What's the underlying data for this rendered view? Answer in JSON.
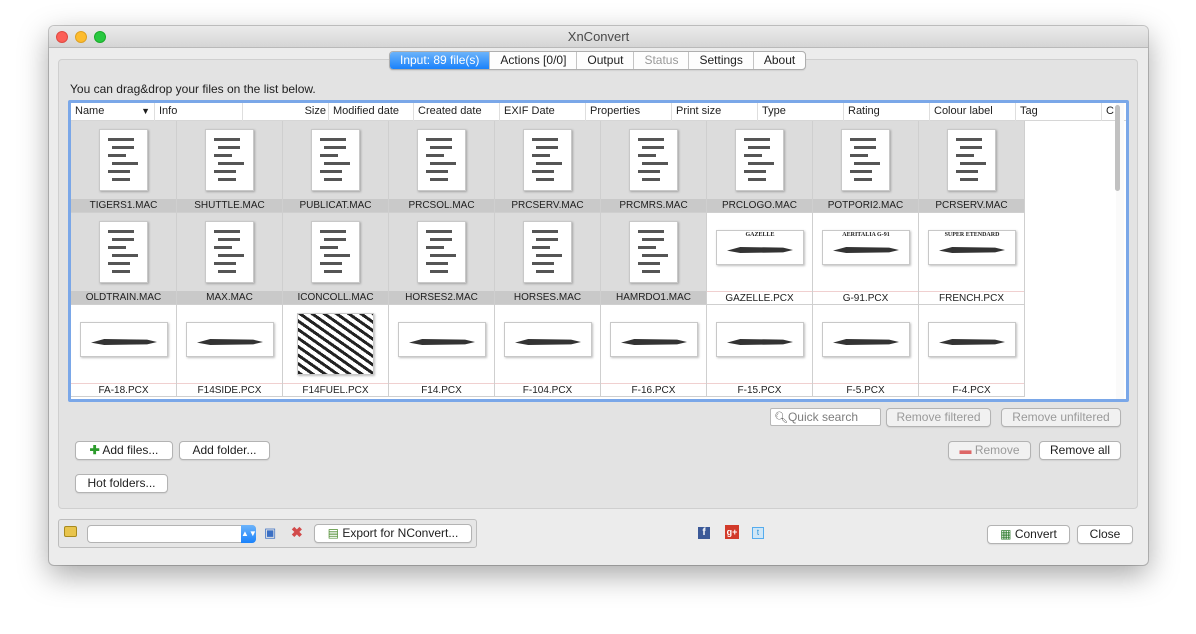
{
  "window": {
    "title": "XnConvert"
  },
  "tabs": [
    {
      "label": "Input: 89 file(s)",
      "state": "active"
    },
    {
      "label": "Actions [0/0]",
      "state": "normal"
    },
    {
      "label": "Output",
      "state": "normal"
    },
    {
      "label": "Status",
      "state": "disabled"
    },
    {
      "label": "Settings",
      "state": "normal"
    },
    {
      "label": "About",
      "state": "normal"
    }
  ],
  "hint": "You can drag&drop your files on the list below.",
  "columns": [
    "Name",
    "Info",
    "Size",
    "Modified date",
    "Created date",
    "EXIF Date",
    "Properties",
    "Print size",
    "Type",
    "Rating",
    "Colour label",
    "Tag",
    "C"
  ],
  "files": [
    [
      "TIGERS1.MAC",
      "SHUTTLE.MAC",
      "PUBLICAT.MAC",
      "PRCSOL.MAC",
      "PRCSERV.MAC",
      "PRCMRS.MAC",
      "PRCLOGO.MAC",
      "POTPORI2.MAC",
      "PCRSERV.MAC"
    ],
    [
      "OLDTRAIN.MAC",
      "MAX.MAC",
      "ICONCOLL.MAC",
      "HORSES2.MAC",
      "HORSES.MAC",
      "HAMRDO1.MAC",
      "GAZELLE.PCX",
      "G-91.PCX",
      "FRENCH.PCX"
    ],
    [
      "FA-18.PCX",
      "F14SIDE.PCX",
      "F14FUEL.PCX",
      "F14.PCX",
      "F-104.PCX",
      "F-16.PCX",
      "F-15.PCX",
      "F-5.PCX",
      "F-4.PCX"
    ]
  ],
  "thumb_text": {
    "gazelle": "GAZELLE",
    "g91": "AERITALIA G-91",
    "french": "SUPER ETENDARD"
  },
  "search": {
    "placeholder": "Quick search"
  },
  "buttons": {
    "remove_filtered": "Remove filtered",
    "remove_unfiltered": "Remove unfiltered",
    "add_files": "Add files...",
    "add_folder": "Add folder...",
    "hot_folders": "Hot folders...",
    "remove": "Remove",
    "remove_all": "Remove all",
    "export": "Export for NConvert...",
    "convert": "Convert",
    "close": "Close"
  },
  "colors": {
    "accent": "#1a82fb",
    "selection_border": "#7aa7e8"
  }
}
